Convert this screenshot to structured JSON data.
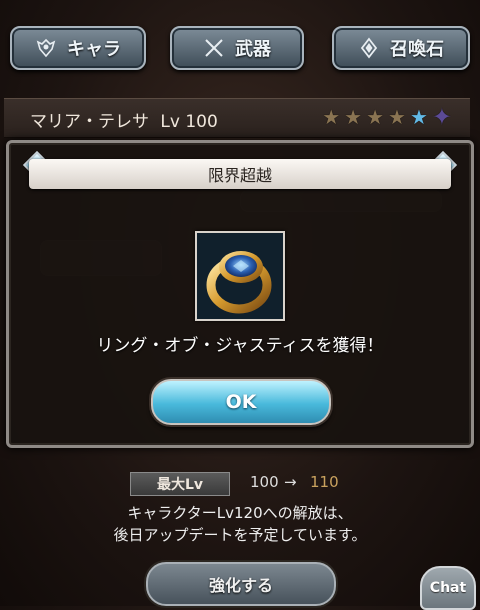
{
  "tabs": [
    {
      "label": "キャラ",
      "icon": "character-emblem-icon"
    },
    {
      "label": "武器",
      "icon": "crossed-swords-icon"
    },
    {
      "label": "召喚石",
      "icon": "summon-stone-icon"
    }
  ],
  "character": {
    "name": "マリア・テレサ",
    "level": "Lv 100",
    "stars_filled": 4,
    "stars_total": 6
  },
  "modal": {
    "title": "限界超越",
    "item_icon": "golden-ring-icon",
    "message": "リング・オブ・ジャスティスを獲得！",
    "ok_label": "OK"
  },
  "max_level": {
    "label": "最大Lv",
    "from": "100",
    "arrow": "→",
    "to": "110"
  },
  "note": {
    "line1": "キャラクターLv120への解放は、",
    "line2": "後日アップデートを予定しています。"
  },
  "enhance_label": "強化する",
  "chat_label": "Chat",
  "colors": {
    "ok_button": "#49b9db",
    "level_target": "#c9a25e",
    "modal_frame": "#8f8a86"
  }
}
